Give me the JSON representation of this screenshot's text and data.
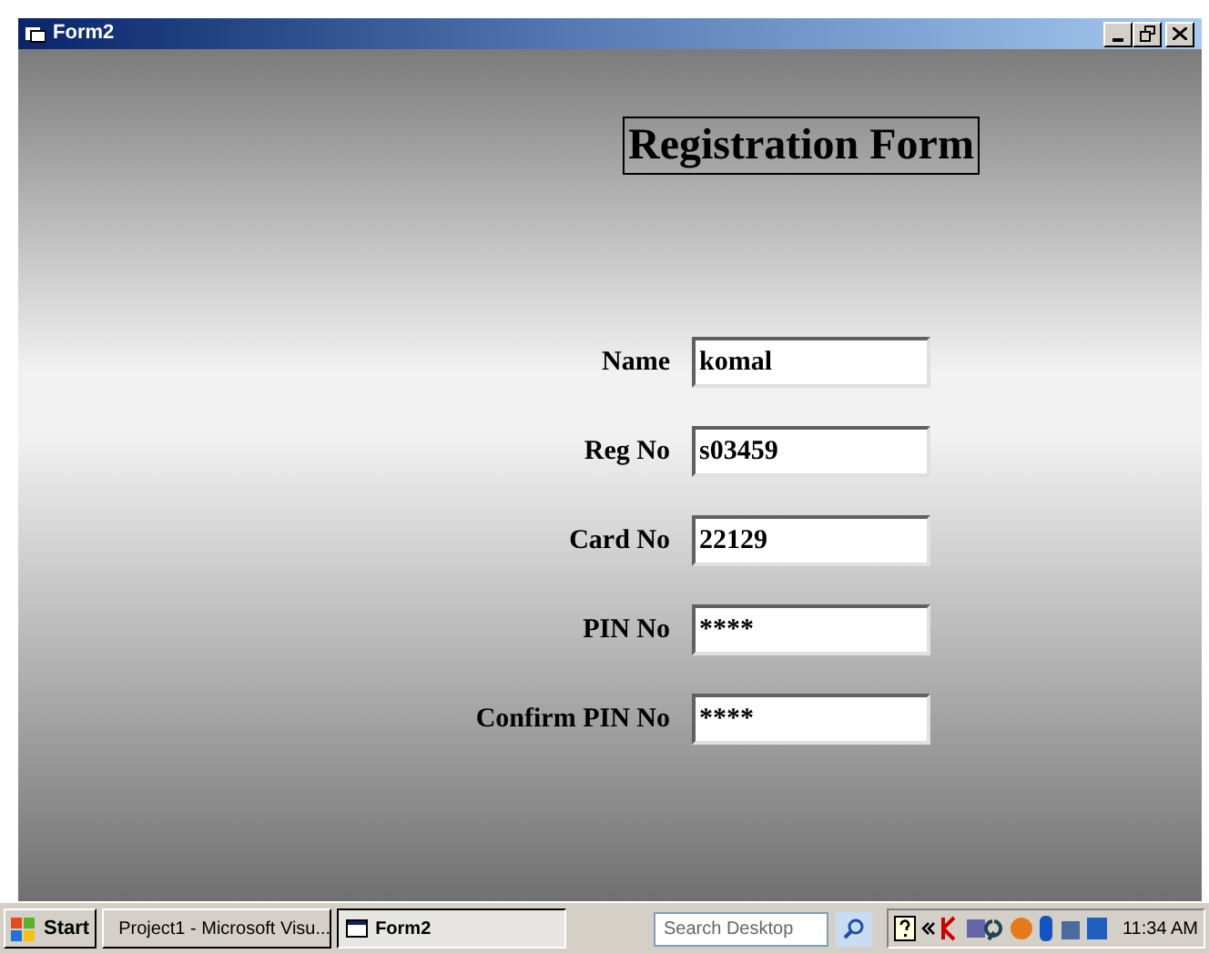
{
  "window": {
    "title": "Form2"
  },
  "form": {
    "heading": "Registration Form",
    "fields": [
      {
        "label": "Name",
        "value": "komal"
      },
      {
        "label": "Reg No",
        "value": "s03459"
      },
      {
        "label": "Card No",
        "value": "22129"
      },
      {
        "label": "PIN No",
        "value": "****"
      },
      {
        "label": "Confirm PIN No",
        "value": "****"
      }
    ]
  },
  "taskbar": {
    "start": "Start",
    "tasks": [
      {
        "label": "Project1 - Microsoft Visu...",
        "selected": false
      },
      {
        "label": "Form2",
        "selected": true
      }
    ],
    "search": {
      "placeholder": "Search Desktop"
    },
    "clock": "11:34 AM"
  }
}
